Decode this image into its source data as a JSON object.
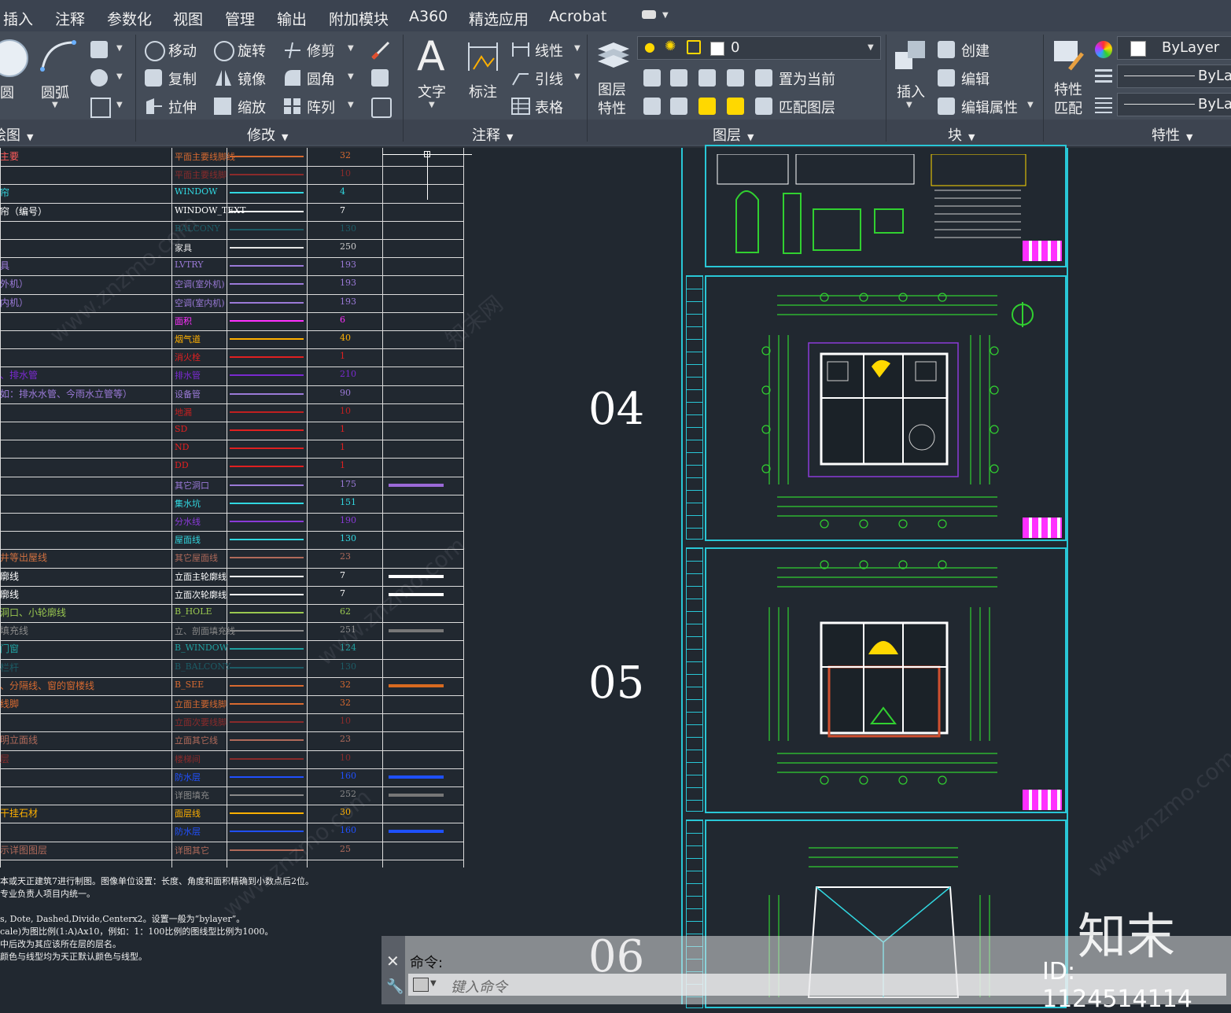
{
  "menu": [
    "插入",
    "注释",
    "参数化",
    "视图",
    "管理",
    "输出",
    "附加模块",
    "A360",
    "精选应用",
    "Acrobat"
  ],
  "ribbon": {
    "draw": {
      "title": "绘图",
      "circle": "圆",
      "arc": "圆弧"
    },
    "modify": {
      "title": "修改",
      "items": [
        "移动",
        "旋转",
        "修剪",
        "复制",
        "镜像",
        "圆角",
        "拉伸",
        "缩放",
        "阵列"
      ]
    },
    "annotation": {
      "title": "注释",
      "text": "文字",
      "dim": "标注",
      "linetype": "线性",
      "leader": "引线",
      "table": "表格"
    },
    "layers": {
      "title": "图层",
      "props": "图层\n特性",
      "current_layer": "0",
      "set_current": "置为当前",
      "match_layer": "匹配图层"
    },
    "block": {
      "title": "块",
      "insert": "插入",
      "create": "创建",
      "edit": "编辑",
      "edit_attr": "编辑属性"
    },
    "properties": {
      "title": "特性",
      "match": "特性\n匹配",
      "color": "ByLayer",
      "linetype": "ByLay",
      "lineweight": "ByLay"
    }
  },
  "layer_table": [
    {
      "desc": "主要",
      "desc_color": "#ff5a5a",
      "name": "平面主要线脚线",
      "name_color": "#d86a30",
      "line": "#d86a30",
      "num": "32",
      "num_color": "#d86a30"
    },
    {
      "desc": "",
      "desc_color": "#cc2b2b",
      "name": "平面主要线脚",
      "name_color": "#8a2b2b",
      "line": "#8a2b2b",
      "num": "10",
      "num_color": "#8a2b2b"
    },
    {
      "desc": "帘",
      "desc_color": "#31d7e0",
      "name": "WINDOW",
      "name_color": "#31d7e0",
      "line": "#31d7e0",
      "num": "4",
      "num_color": "#31d7e0"
    },
    {
      "desc": "帘（编号）",
      "desc_color": "#ffffff",
      "name": "WINDOW_TEXT",
      "name_color": "#ffffff",
      "line": "#ffffff",
      "num": "7",
      "num_color": "#ffffff"
    },
    {
      "desc": "",
      "desc_color": "#1c5c66",
      "name": "BALCONY",
      "name_color": "#1c5c66",
      "line": "#1c5c66",
      "num": "130",
      "num_color": "#1c5c66"
    },
    {
      "desc": "",
      "desc_color": "#cccccc",
      "name": "家具",
      "name_color": "#e6e6e6",
      "line": "#e6e6e6",
      "num": "250",
      "num_color": "#cccccc"
    },
    {
      "desc": "具",
      "desc_color": "#9b7ad8",
      "name": "LVTRY",
      "name_color": "#9b7ad8",
      "line": "#9b7ad8",
      "num": "193",
      "num_color": "#9b7ad8"
    },
    {
      "desc": "外机）",
      "desc_color": "#9b7ad8",
      "name": "空调(室外机)",
      "name_color": "#9b7ad8",
      "line": "#9b7ad8",
      "num": "193",
      "num_color": "#9b7ad8"
    },
    {
      "desc": "内机）",
      "desc_color": "#9b7ad8",
      "name": "空调(室内机)",
      "name_color": "#9b7ad8",
      "line": "#9b7ad8",
      "num": "193",
      "num_color": "#9b7ad8"
    },
    {
      "desc": "",
      "desc_color": "#ff30ff",
      "name": "面积",
      "name_color": "#ff30ff",
      "line": "#ff30ff",
      "num": "6",
      "num_color": "#ff30ff"
    },
    {
      "desc": "",
      "desc_color": "#ffb000",
      "name": "烟气道",
      "name_color": "#ffb000",
      "line": "#ffb000",
      "num": "40",
      "num_color": "#ffb000"
    },
    {
      "desc": "",
      "desc_color": "#e02020",
      "name": "消火栓",
      "name_color": "#e02020",
      "line": "#e02020",
      "num": "1",
      "num_color": "#e02020"
    },
    {
      "desc": "、排水管",
      "desc_color": "#7a2ad0",
      "name": "排水管",
      "name_color": "#7a2ad0",
      "line": "#7a2ad0",
      "num": "210",
      "num_color": "#7a2ad0"
    },
    {
      "desc": "如：排水水管、今雨水立管等）",
      "desc_color": "#9b7ad8",
      "name": "设备管",
      "name_color": "#9b7ad8",
      "line": "#9b7ad8",
      "num": "90",
      "num_color": "#9b7ad8"
    },
    {
      "desc": "",
      "desc_color": "#c02020",
      "name": "地漏",
      "name_color": "#c02020",
      "line": "#c02020",
      "num": "10",
      "num_color": "#c02020"
    },
    {
      "desc": "",
      "desc_color": "#e02020",
      "name": "SD",
      "name_color": "#e02020",
      "line": "#e02020",
      "num": "1",
      "num_color": "#e02020"
    },
    {
      "desc": "",
      "desc_color": "#e02020",
      "name": "ND",
      "name_color": "#e02020",
      "line": "#e02020",
      "num": "1",
      "num_color": "#e02020"
    },
    {
      "desc": "",
      "desc_color": "#e02020",
      "name": "DD",
      "name_color": "#e02020",
      "line": "#e02020",
      "num": "1",
      "num_color": "#e02020"
    },
    {
      "desc": "",
      "desc_color": "#9b7ad8",
      "name": "其它洞口",
      "name_color": "#9b7ad8",
      "line": "#9b7ad8",
      "num": "175",
      "num_color": "#9b7ad8",
      "sample": "#9b6ad8"
    },
    {
      "desc": "",
      "desc_color": "#31d7e0",
      "name": "集水坑",
      "name_color": "#31d7e0",
      "line": "#31d7e0",
      "num": "151",
      "num_color": "#31d7e0"
    },
    {
      "desc": "",
      "desc_color": "#8a3ad8",
      "name": "分水线",
      "name_color": "#8a3ad8",
      "line": "#8a3ad8",
      "num": "190",
      "num_color": "#8a3ad8"
    },
    {
      "desc": "",
      "desc_color": "#31d7e0",
      "name": "屋面线",
      "name_color": "#31d7e0",
      "line": "#31d7e0",
      "num": "130",
      "num_color": "#31d7e0"
    },
    {
      "desc": "井等出屋线",
      "desc_color": "#d07040",
      "name": "其它屋面线",
      "name_color": "#b06a5a",
      "line": "#b06a5a",
      "num": "23",
      "num_color": "#b06a5a"
    },
    {
      "desc": "廓线",
      "desc_color": "#ffffff",
      "name": "立面主轮廓线",
      "name_color": "#ffffff",
      "line": "#ffffff",
      "num": "7",
      "num_color": "#ffffff",
      "sample": "#ffffff"
    },
    {
      "desc": "廓线",
      "desc_color": "#ffffff",
      "name": "立面次轮廓线",
      "name_color": "#ffffff",
      "line": "#ffffff",
      "num": "7",
      "num_color": "#ffffff",
      "sample": "#ffffff"
    },
    {
      "desc": "洞口、小轮廓线",
      "desc_color": "#9ac850",
      "name": "B_HOLE",
      "name_color": "#9ac850",
      "line": "#9ac850",
      "num": "62",
      "num_color": "#9ac850"
    },
    {
      "desc": "填充线",
      "desc_color": "#8a8a8a",
      "name": "立、剖面填充线",
      "name_color": "#8a8a8a",
      "line": "#8a8a8a",
      "num": "251",
      "num_color": "#8a8a8a",
      "sample": "#777777"
    },
    {
      "desc": "门窗",
      "desc_color": "#20a0a0",
      "name": "B_WINDOW",
      "name_color": "#20a0a0",
      "line": "#20a0a0",
      "num": "124",
      "num_color": "#20a0a0"
    },
    {
      "desc": "栏杆",
      "desc_color": "#1c5c66",
      "name": "B_BALCONY",
      "name_color": "#1c5c66",
      "line": "#1c5c66",
      "num": "130",
      "num_color": "#1c5c66"
    },
    {
      "desc": "、分隔线、窗的窗楼线",
      "desc_color": "#d86a30",
      "name": "B_SEE",
      "name_color": "#d86a30",
      "line": "#d86a30",
      "num": "32",
      "num_color": "#d86a30",
      "sample": "#d86a20"
    },
    {
      "desc": "线脚",
      "desc_color": "#d86a30",
      "name": "立面主要线脚",
      "name_color": "#d86a30",
      "line": "#d86a30",
      "num": "32",
      "num_color": "#d86a30"
    },
    {
      "desc": "",
      "desc_color": "#8a2b2b",
      "name": "立面次要线脚",
      "name_color": "#8a2b2b",
      "line": "#8a2b2b",
      "num": "10",
      "num_color": "#8a2b2b"
    },
    {
      "desc": "明立面线",
      "desc_color": "#b06a5a",
      "name": "立面其它线",
      "name_color": "#b06a5a",
      "line": "#b06a5a",
      "num": "23",
      "num_color": "#b06a5a"
    },
    {
      "desc": "层",
      "desc_color": "#8a2b2b",
      "name": "楼梯间",
      "name_color": "#8a2b2b",
      "line": "#8a2b2b",
      "num": "10",
      "num_color": "#8a2b2b"
    },
    {
      "desc": "",
      "desc_color": "#2050ff",
      "name": "防水层",
      "name_color": "#2050ff",
      "line": "#2050ff",
      "num": "160",
      "num_color": "#2050ff",
      "sample": "#1e50ff"
    },
    {
      "desc": "",
      "desc_color": "#8a8a8a",
      "name": "详图填充",
      "name_color": "#8a8a8a",
      "line": "#8a8a8a",
      "num": "252",
      "num_color": "#8a8a8a",
      "sample": "#777777"
    },
    {
      "desc": "干挂石材",
      "desc_color": "#ffb000",
      "name": "面层线",
      "name_color": "#ffb000",
      "line": "#ffb000",
      "num": "30",
      "num_color": "#ffb000"
    },
    {
      "desc": "",
      "desc_color": "#2050ff",
      "name": "防水层",
      "name_color": "#2050ff",
      "line": "#2050ff",
      "num": "160",
      "num_color": "#2050ff",
      "sample": "#1e50ff"
    },
    {
      "desc": "示详图图层",
      "desc_color": "#b06a5a",
      "name": "详图其它",
      "name_color": "#b06a5a",
      "line": "#b06a5a",
      "num": "25",
      "num_color": "#b06a5a"
    }
  ],
  "notes": [
    "本或天正建筑7进行制图。图像单位设置：长度、角度和面积精确到小数点后2位。",
    "专业负责人项目内统一。",
    "",
    "s, Dote, Dashed,Divide,Centerx2。设置一般为“bylayer”。",
    "cale)为图比例(1:A)Ax10，例如：1：100比例的图线型比例为1000。",
    "中后改为其应该所在层的层名。",
    "颜色与线型均为天正默认颜色与线型。"
  ],
  "sheets": [
    {
      "num": "04"
    },
    {
      "num": "05"
    },
    {
      "num": "06"
    }
  ],
  "command": {
    "prompt": "命令:",
    "placeholder": "键入命令"
  },
  "watermark": {
    "logo": "知末",
    "id": "ID: 1124514114",
    "site": "www.znzmo.com",
    "site_cn": "知末网"
  }
}
